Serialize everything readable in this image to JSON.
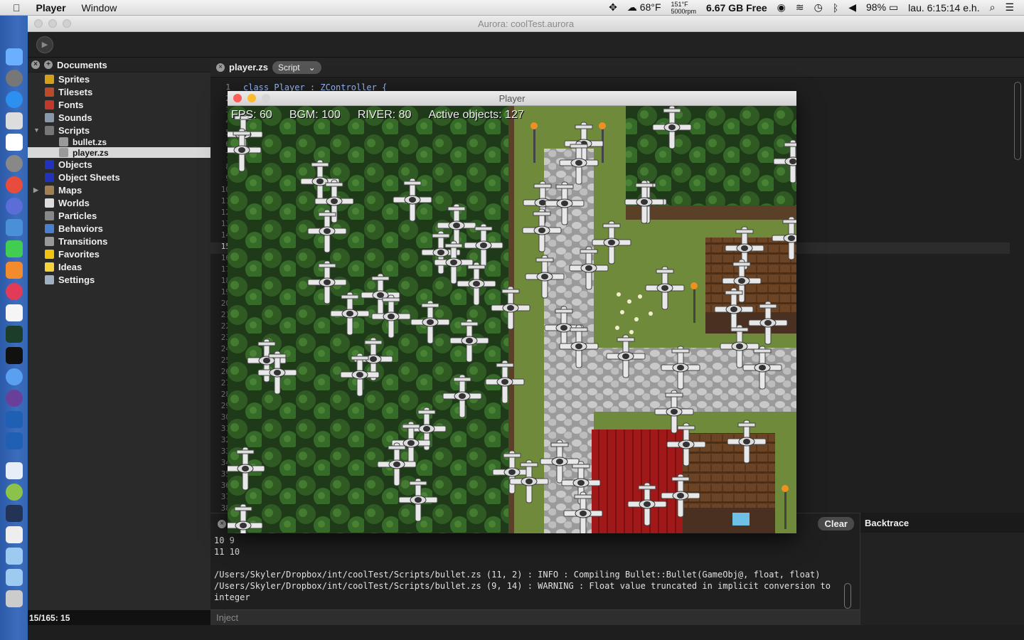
{
  "menubar": {
    "app_name": "Player",
    "menu_window": "Window",
    "temperature": "68°F",
    "cpu_temp": "151°F",
    "fan_rpm": "5000rpm",
    "disk_free": "6.67 GB Free",
    "battery": "98%",
    "clock": "lau. 6:15:14 e.h."
  },
  "window": {
    "title": "Aurora: coolTest.aurora"
  },
  "sidebar": {
    "header": "Documents",
    "items": [
      {
        "label": "Sprites",
        "icon": "sprites-icon",
        "color": "#d4a017"
      },
      {
        "label": "Tilesets",
        "icon": "tilesets-icon",
        "color": "#b94a2a"
      },
      {
        "label": "Fonts",
        "icon": "fonts-icon",
        "color": "#c0392b"
      },
      {
        "label": "Sounds",
        "icon": "sounds-icon",
        "color": "#8899aa"
      },
      {
        "label": "Scripts",
        "icon": "scripts-icon",
        "color": "#777777"
      },
      {
        "label": "bullet.zs",
        "icon": "file-icon",
        "color": "#999999"
      },
      {
        "label": "player.zs",
        "icon": "file-icon",
        "color": "#999999"
      },
      {
        "label": "Objects",
        "icon": "objects-icon",
        "color": "#2233bb"
      },
      {
        "label": "Object Sheets",
        "icon": "object-sheets-icon",
        "color": "#2233bb"
      },
      {
        "label": "Maps",
        "icon": "maps-icon",
        "color": "#a08050"
      },
      {
        "label": "Worlds",
        "icon": "worlds-icon",
        "color": "#dddddd"
      },
      {
        "label": "Particles",
        "icon": "particles-icon",
        "color": "#888888"
      },
      {
        "label": "Behaviors",
        "icon": "behaviors-icon",
        "color": "#4a7fd0"
      },
      {
        "label": "Transitions",
        "icon": "transitions-icon",
        "color": "#999999"
      },
      {
        "label": "Favorites",
        "icon": "star-icon",
        "color": "#f1c40f"
      },
      {
        "label": "Ideas",
        "icon": "lightbulb-icon",
        "color": "#f5d33a"
      },
      {
        "label": "Settings",
        "icon": "gear-icon",
        "color": "#a0b0c0"
      }
    ],
    "status": "15/165: 15"
  },
  "editor": {
    "tab_name": "player.zs",
    "mode_select": "Script",
    "first_line": "class Player : ZController {",
    "line_numbers": [
      "1",
      "2",
      "3",
      "4",
      "5",
      "6",
      "7",
      "8",
      "9",
      "10",
      "11",
      "12",
      "13",
      "14",
      "15",
      "16",
      "17",
      "18",
      "19",
      "20",
      "21",
      "22",
      "23",
      "24",
      "25",
      "26",
      "27",
      "28",
      "29",
      "30",
      "31",
      "32",
      "33",
      "34",
      "35",
      "36",
      "37",
      "38"
    ],
    "current_line": "15"
  },
  "console": {
    "log": "10 9\n11 10\n\n/Users/Skyler/Dropbox/int/coolTest/Scripts/bullet.zs (11, 2) : INFO : Compiling Bullet::Bullet(GameObj@, float, float)\n/Users/Skyler/Dropbox/int/coolTest/Scripts/bullet.zs (9, 14) : WARNING : Float value truncated in implicit conversion to\ninteger",
    "clear_label": "Clear",
    "inject_placeholder": "Inject"
  },
  "backtrace": {
    "title": "Backtrace"
  },
  "player": {
    "title": "Player",
    "hud": {
      "fps": "FPS: 60",
      "bgm": "BGM: 100",
      "river": "RIVER: 80",
      "objects": "Active objects: 127"
    }
  }
}
